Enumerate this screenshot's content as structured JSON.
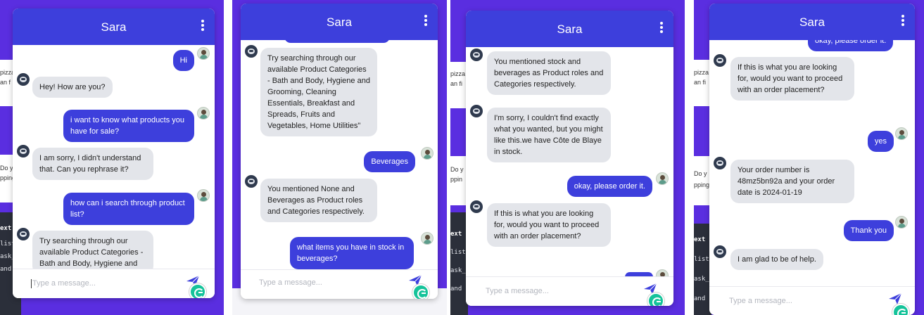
{
  "colors": {
    "header": "#3d3fdc",
    "user_bubble": "#3d3fdc",
    "bot_bubble": "#e3e5ea",
    "page_accent": "#5a2ee0"
  },
  "icons": {
    "menu": "kebab-menu-icon",
    "send": "send-paper-plane-icon",
    "grammarly": "grammarly-icon",
    "bot_avatar": "bot-avatar-icon",
    "user_avatar": "user-avatar-icon"
  },
  "panels": [
    {
      "title": "Sara",
      "placeholder": "Type a message...",
      "background_peek": [
        "pizza",
        "an f",
        "Do y",
        "pping",
        "ext",
        "list",
        "ask_",
        "and"
      ],
      "messages": [
        {
          "from": "user",
          "text": "Hi"
        },
        {
          "from": "bot",
          "text": "Hey! How are you?"
        },
        {
          "from": "user",
          "text": "i want to know what products you have for sale?"
        },
        {
          "from": "bot",
          "text": "I am sorry, I didn't understand that. Can you rephrase it?"
        },
        {
          "from": "user",
          "text": "how can i search through product list?"
        },
        {
          "from": "bot",
          "text": "Try searching through our available Product Categories - Bath and Body, Hygiene and"
        }
      ]
    },
    {
      "title": "Sara",
      "placeholder": "Type a message...",
      "background_peek": [],
      "messages": [
        {
          "from": "bot",
          "text": "Try searching through our available Product Categories - Bath and Body, Hygiene and Grooming, Cleaning Essentials, Breakfast and Spreads, Fruits and Vegetables, Home Utilities\""
        },
        {
          "from": "user",
          "text": "Beverages"
        },
        {
          "from": "bot",
          "text": "You mentioned None and Beverages as Product roles and Categories respectively."
        },
        {
          "from": "user",
          "text": "what items you have in stock in beverages?"
        }
      ]
    },
    {
      "title": "Sara",
      "placeholder": "Type a message...",
      "background_peek": [
        "pizza",
        "an fi",
        "Do y",
        "ppin",
        "ext",
        "list",
        "ask_",
        "and"
      ],
      "messages": [
        {
          "from": "bot",
          "text": "You mentioned stock and beverages as Product roles and Categories respectively."
        },
        {
          "from": "bot",
          "text": "I'm sorry, I couldn't find exactly what you wanted, but you might like this.we have Côte de Blaye in stock."
        },
        {
          "from": "user",
          "text": "okay, please order it."
        },
        {
          "from": "bot",
          "text": "If this is what you are looking for, would you want to proceed with an order placement?"
        }
      ]
    },
    {
      "title": "Sara",
      "placeholder": "Type a message...",
      "background_peek": [
        "pizza",
        "an fi",
        "Do y",
        "pping",
        "ext",
        "list",
        "ask_",
        "and"
      ],
      "messages": [
        {
          "from": "user",
          "text": "okay, please order it."
        },
        {
          "from": "bot",
          "text": "If this is what you are looking for, would you want to proceed with an order placement?"
        },
        {
          "from": "user",
          "text": "yes"
        },
        {
          "from": "bot",
          "text": "Your order number is 48mz5bn92a and your order date is 2024-01-19"
        },
        {
          "from": "user",
          "text": "Thank you"
        },
        {
          "from": "bot",
          "text": "I am glad to be of help."
        }
      ]
    }
  ]
}
